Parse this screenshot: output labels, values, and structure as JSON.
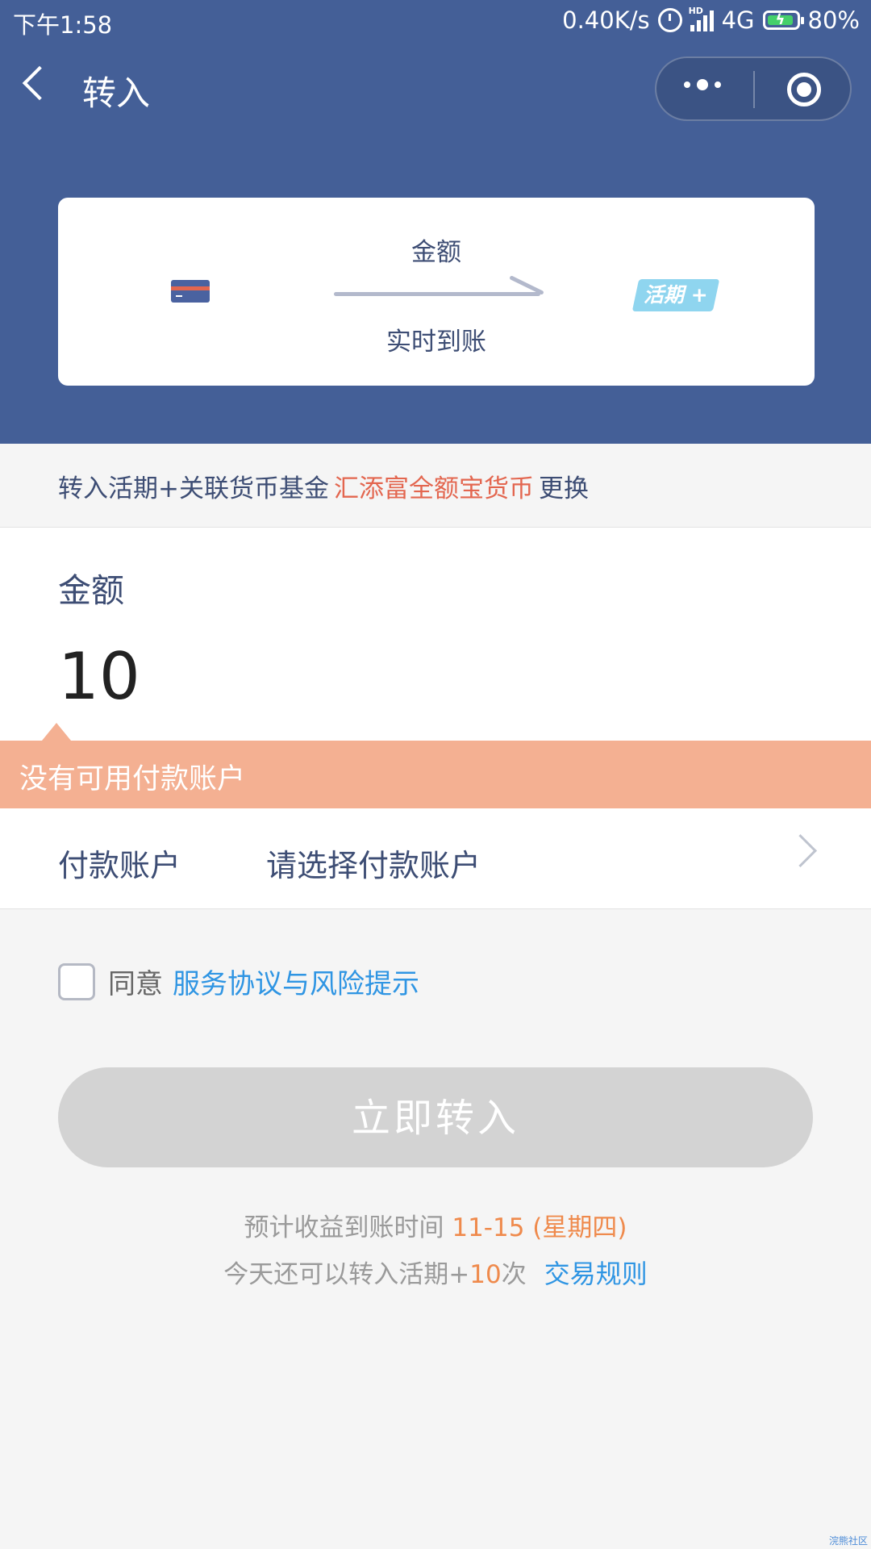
{
  "status_bar": {
    "time": "下午1:58",
    "net_speed": "0.40K/s",
    "network": "4G",
    "battery": "80%"
  },
  "nav": {
    "title": "转入"
  },
  "card": {
    "amount_label": "金额",
    "realtime_label": "实时到账",
    "badge": "活期 +"
  },
  "fund": {
    "prefix": "转入活期+关联货币基金",
    "fund_name": "汇添富全额宝货币",
    "change": "更换"
  },
  "amount": {
    "label": "金额",
    "value": "10"
  },
  "warning": "没有可用付款账户",
  "payment": {
    "label": "付款账户",
    "placeholder": "请选择付款账户"
  },
  "agreement": {
    "text": "同意",
    "link": "服务协议与风险提示"
  },
  "submit_label": "立即转入",
  "info": {
    "line1_prefix": "预计收益到账时间",
    "line1_date": "11-15 (星期四)",
    "line2_prefix": "今天还可以转入活期+",
    "line2_count": "10",
    "line2_suffix": "次",
    "rules_link": "交易规则"
  },
  "watermark": "浣熊社区",
  "colors": {
    "header_blue": "#445f97",
    "accent_red": "#e3664f",
    "warning_bg": "#f4b092",
    "link_blue": "#2f95e3",
    "orange": "#ef8a4c"
  }
}
